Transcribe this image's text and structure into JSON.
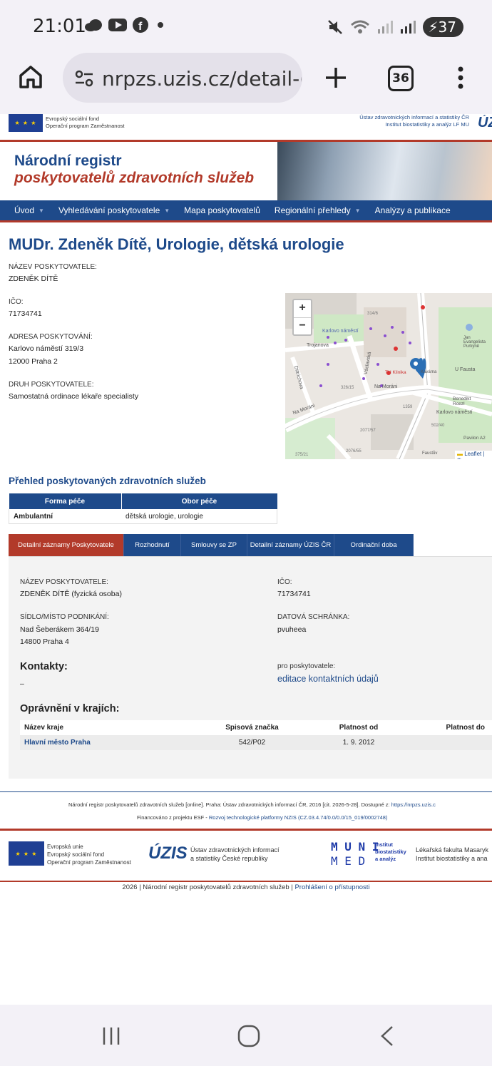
{
  "status": {
    "time": "21:01",
    "battery": "37"
  },
  "browser": {
    "url": "nrpzs.uzis.cz/detail-(",
    "tab_count": "36"
  },
  "top_strip": {
    "esf_line1": "Evropský sociální fond",
    "esf_line2": "Operační program Zaměstnanost",
    "uzis_line1": "Ústav zdravotnických informací a statistiky ČR",
    "uzis_line2": "Institut biostatistiky a analýz LF MU",
    "uzis_logo": "ÚZ"
  },
  "banner": {
    "line1": "Národní registr",
    "line2": "poskytovatelů zdravotních služeb"
  },
  "nav": [
    {
      "label": "Úvod",
      "caret": true
    },
    {
      "label": "Vyhledávání poskytovatele",
      "caret": true
    },
    {
      "label": "Mapa poskytovatelů",
      "caret": false
    },
    {
      "label": "Regionální přehledy",
      "caret": true
    },
    {
      "label": "Analýzy a publikace",
      "caret": false
    }
  ],
  "page_title": "MUDr. Zdeněk Dítě, Urologie, dětská urologie",
  "details": [
    {
      "label": "NÁZEV POSKYTOVATELE:",
      "value": "ZDENĚK DÍTĚ"
    },
    {
      "label": "IČO:",
      "value": "71734741"
    },
    {
      "label": "ADRESA POSKYTOVÁNÍ:",
      "value": "Karlovo náměstí 319/3",
      "value2": "12000 Praha 2"
    },
    {
      "label": "DRUH POSKYTOVATELE:",
      "value": "Samostatná ordinace lékaře specialisty"
    }
  ],
  "map": {
    "zoom_in": "+",
    "zoom_out": "−",
    "labels": [
      "Karlovo náměstí",
      "Trojanova",
      "Václavská",
      "Dittrichova",
      "Na Moráni",
      "Na Moráni",
      "TH Klinika",
      "Kavárna",
      "U Fausta",
      "Jan Evangelista Purkyně",
      "Benedikt Roezl",
      "Karlovo náměstí",
      "Pavilon A2",
      "Faustův",
      "1359",
      "326/15",
      "2077/57",
      "2076/55",
      "375/21",
      "502/40",
      "314/6"
    ],
    "attribution": "Leaflet | ©"
  },
  "services": {
    "heading": "Přehled poskytovaných zdravotních služeb",
    "columns": [
      "Forma péče",
      "Obor péče"
    ],
    "rows": [
      [
        "Ambulantní",
        "dětská urologie, urologie"
      ]
    ]
  },
  "tabs": [
    {
      "label": "Detailní záznamy Poskytovatele",
      "active": true
    },
    {
      "label": "Rozhodnutí",
      "active": false
    },
    {
      "label": "Smlouvy se ZP",
      "active": false
    },
    {
      "label": "Detailní záznamy ÚZIS ČR",
      "active": false
    },
    {
      "label": "Ordinační doba",
      "active": false
    }
  ],
  "panel": {
    "name_label": "NÁZEV POSKYTOVATELE:",
    "name_value": "ZDENĚK DÍTĚ (fyzická osoba)",
    "ico_label": "IČO:",
    "ico_value": "71734741",
    "seat_label": "SÍDLO/MÍSTO PODNIKÁNÍ:",
    "seat_value1": "Nad Šeberákem 364/19",
    "seat_value2": "14800 Praha 4",
    "databox_label": "DATOVÁ SCHRÁNKA:",
    "databox_value": "pvuheea",
    "contacts_heading": "Kontakty:",
    "contacts_value": "–",
    "for_provider": "pro poskytovatele:",
    "edit_link": "editace kontaktních údajů",
    "rights_heading": "Oprávnění v krajích:",
    "rights_columns": [
      "Název kraje",
      "Spisová značka",
      "Platnost od",
      "Platnost do"
    ],
    "rights_rows": [
      [
        "Hlavní město Praha",
        "542/P02",
        "1. 9. 2012",
        ""
      ]
    ]
  },
  "footer": {
    "citation_a": "Národní registr poskytovatelů zdravotních služeb [online]. Praha: Ústav zdravotnických informací ČR, 2016 [cit. 2026-5-28]. Dostupné z: ",
    "citation_link": "https://nrpzs.uzis.c",
    "funding_a": "Financováno z projektu ESF - ",
    "funding_link": "Rozvoj technologické platformy NZIS (CZ.03.4.74/0.0/0.0/15_019/0002748)",
    "eu_line1": "Evropská unie",
    "eu_line2": "Evropský sociální fond",
    "eu_line3": "Operační program Zaměstnanost",
    "uzis_logo": "ÚZIS",
    "uzis_line1": "Ústav zdravotnických informací",
    "uzis_line2": "a statistiky České republiky",
    "muni_logo_1": "M U N I",
    "muni_logo_2": "M E D",
    "iba_line1": "Institut",
    "iba_line2": "biostatistiky",
    "iba_line3": "a analýz",
    "lf_line1": "Lékařská fakulta Masaryk",
    "lf_line2": "Institut biostatistiky a ana",
    "copyright": "2026 | Národní registr poskytovatelů zdravotních služeb | ",
    "accessibility_link": "Prohlášení o přístupnosti"
  },
  "colors": {
    "brand_blue": "#1e4a8a",
    "brand_red": "#b23a2a"
  }
}
